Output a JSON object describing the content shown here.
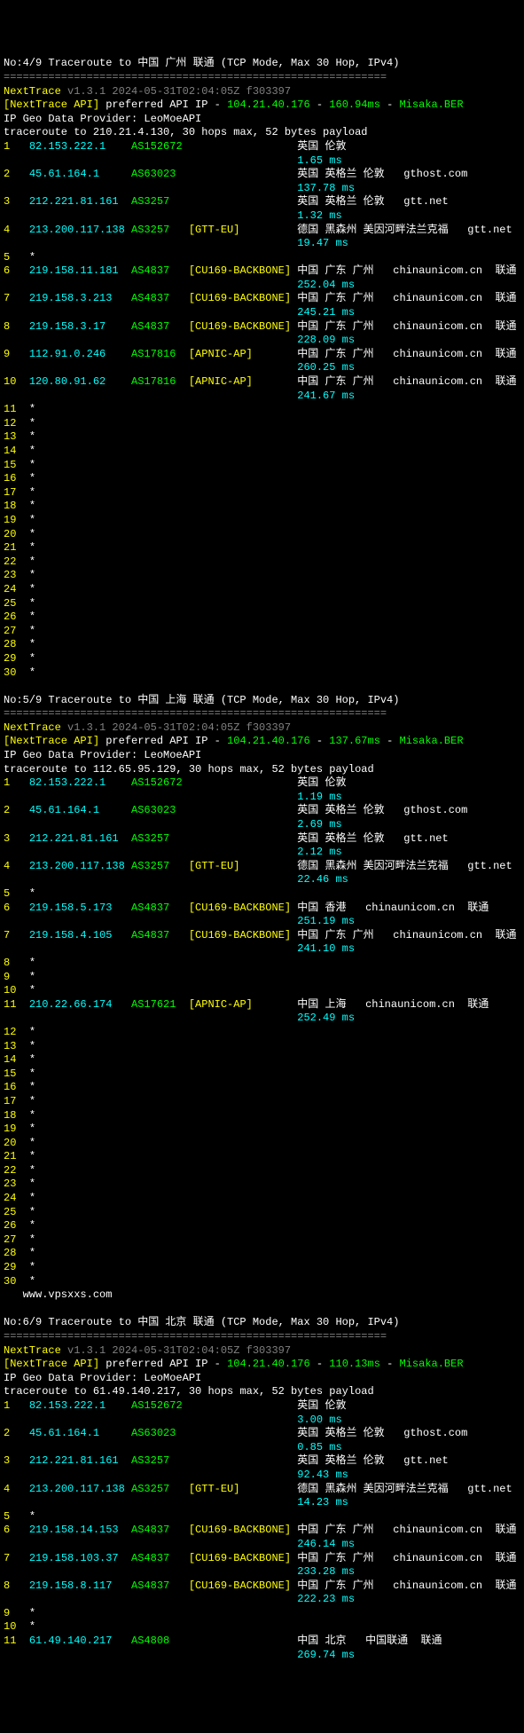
{
  "watermark": "www.vpsxxs.com",
  "traces": [
    {
      "header": "No:4/9 Traceroute to 中国 广州 联通 (TCP Mode, Max 30 Hop, IPv4)",
      "divider": "============================================================",
      "nexttrace_label": "NextTrace",
      "nexttrace_info": " v1.3.1 2024-05-31T02:04:05Z f303397",
      "api_label": "[NextTrace API]",
      "api_text": " preferred API IP - ",
      "api_ip": "104.21.40.176",
      "api_dash": " - ",
      "api_ms": "160.94ms",
      "api_dash2": " - ",
      "api_src": "Misaka.BER",
      "geo_line": "IP Geo Data Provider: LeoMoeAPI",
      "trace_line": "traceroute to 210.21.4.130, 30 hops max, 52 bytes payload",
      "hops": [
        {
          "n": "1",
          "ip": "82.153.222.1",
          "asn": "AS152672",
          "tag": "",
          "loc": "英国 伦敦",
          "ms": "1.65 ms",
          "dom": ""
        },
        {
          "n": "2",
          "ip": "45.61.164.1",
          "asn": "AS63023",
          "tag": "",
          "loc": "英国 英格兰 伦敦",
          "ms": "137.78 ms",
          "dom": "gthost.com"
        },
        {
          "n": "3",
          "ip": "212.221.81.161",
          "asn": "AS3257",
          "tag": "",
          "loc": "英国 英格兰 伦敦",
          "ms": "1.32 ms",
          "dom": "gtt.net"
        },
        {
          "n": "4",
          "ip": "213.200.117.138",
          "asn": "AS3257",
          "tag": "[GTT-EU]",
          "loc": "德国 黑森州 美因河畔法兰克福",
          "ms": "19.47 ms",
          "dom": "gtt.net"
        },
        {
          "n": "5",
          "ip": "*",
          "asn": "",
          "tag": "",
          "loc": "",
          "ms": "",
          "dom": ""
        },
        {
          "n": "6",
          "ip": "219.158.11.181",
          "asn": "AS4837",
          "tag": "[CU169-BACKBONE]",
          "loc": "中国 广东 广州",
          "ms": "252.04 ms",
          "dom": "chinaunicom.cn  联通"
        },
        {
          "n": "7",
          "ip": "219.158.3.213",
          "asn": "AS4837",
          "tag": "[CU169-BACKBONE]",
          "loc": "中国 广东 广州",
          "ms": "245.21 ms",
          "dom": "chinaunicom.cn  联通"
        },
        {
          "n": "8",
          "ip": "219.158.3.17",
          "asn": "AS4837",
          "tag": "[CU169-BACKBONE]",
          "loc": "中国 广东 广州",
          "ms": "228.09 ms",
          "dom": "chinaunicom.cn  联通"
        },
        {
          "n": "9",
          "ip": "112.91.0.246",
          "asn": "AS17816",
          "tag": "[APNIC-AP]",
          "loc": "中国 广东 广州",
          "ms": "260.25 ms",
          "dom": "chinaunicom.cn  联通"
        },
        {
          "n": "10",
          "ip": "120.80.91.62",
          "asn": "AS17816",
          "tag": "[APNIC-AP]",
          "loc": "中国 广东 广州",
          "ms": "241.67 ms",
          "dom": "chinaunicom.cn  联通"
        },
        {
          "n": "11",
          "ip": "*"
        },
        {
          "n": "12",
          "ip": "*"
        },
        {
          "n": "13",
          "ip": "*"
        },
        {
          "n": "14",
          "ip": "*"
        },
        {
          "n": "15",
          "ip": "*"
        },
        {
          "n": "16",
          "ip": "*"
        },
        {
          "n": "17",
          "ip": "*"
        },
        {
          "n": "18",
          "ip": "*"
        },
        {
          "n": "19",
          "ip": "*"
        },
        {
          "n": "20",
          "ip": "*"
        },
        {
          "n": "21",
          "ip": "*"
        },
        {
          "n": "22",
          "ip": "*"
        },
        {
          "n": "23",
          "ip": "*"
        },
        {
          "n": "24",
          "ip": "*"
        },
        {
          "n": "25",
          "ip": "*"
        },
        {
          "n": "26",
          "ip": "*"
        },
        {
          "n": "27",
          "ip": "*"
        },
        {
          "n": "28",
          "ip": "*"
        },
        {
          "n": "29",
          "ip": "*"
        },
        {
          "n": "30",
          "ip": "*"
        }
      ]
    },
    {
      "header": "No:5/9 Traceroute to 中国 上海 联通 (TCP Mode, Max 30 Hop, IPv4)",
      "divider": "============================================================",
      "nexttrace_label": "NextTrace",
      "nexttrace_info": " v1.3.1 2024-05-31T02:04:05Z f303397",
      "api_label": "[NextTrace API]",
      "api_text": " preferred API IP - ",
      "api_ip": "104.21.40.176",
      "api_dash": " - ",
      "api_ms": "137.67ms",
      "api_dash2": " - ",
      "api_src": "Misaka.BER",
      "geo_line": "IP Geo Data Provider: LeoMoeAPI",
      "trace_line": "traceroute to 112.65.95.129, 30 hops max, 52 bytes payload",
      "hops": [
        {
          "n": "1",
          "ip": "82.153.222.1",
          "asn": "AS152672",
          "tag": "",
          "loc": "英国 伦敦",
          "ms": "1.19 ms",
          "dom": ""
        },
        {
          "n": "2",
          "ip": "45.61.164.1",
          "asn": "AS63023",
          "tag": "",
          "loc": "英国 英格兰 伦敦",
          "ms": "2.69 ms",
          "dom": "gthost.com"
        },
        {
          "n": "3",
          "ip": "212.221.81.161",
          "asn": "AS3257",
          "tag": "",
          "loc": "英国 英格兰 伦敦",
          "ms": "2.12 ms",
          "dom": "gtt.net"
        },
        {
          "n": "4",
          "ip": "213.200.117.138",
          "asn": "AS3257",
          "tag": "[GTT-EU]",
          "loc": "德国 黑森州 美因河畔法兰克福",
          "ms": "22.46 ms",
          "dom": "gtt.net"
        },
        {
          "n": "5",
          "ip": "*"
        },
        {
          "n": "6",
          "ip": "219.158.5.173",
          "asn": "AS4837",
          "tag": "[CU169-BACKBONE]",
          "loc": "中国 香港",
          "ms": "251.19 ms",
          "dom": "chinaunicom.cn  联通"
        },
        {
          "n": "7",
          "ip": "219.158.4.105",
          "asn": "AS4837",
          "tag": "[CU169-BACKBONE]",
          "loc": "中国 广东 广州",
          "ms": "241.10 ms",
          "dom": "chinaunicom.cn  联通"
        },
        {
          "n": "8",
          "ip": "*"
        },
        {
          "n": "9",
          "ip": "*"
        },
        {
          "n": "10",
          "ip": "*"
        },
        {
          "n": "11",
          "ip": "210.22.66.174",
          "asn": "AS17621",
          "tag": "[APNIC-AP]",
          "loc": "中国 上海",
          "ms": "252.49 ms",
          "dom": "chinaunicom.cn  联通"
        },
        {
          "n": "12",
          "ip": "*"
        },
        {
          "n": "13",
          "ip": "*"
        },
        {
          "n": "14",
          "ip": "*"
        },
        {
          "n": "15",
          "ip": "*"
        },
        {
          "n": "16",
          "ip": "*"
        },
        {
          "n": "17",
          "ip": "*"
        },
        {
          "n": "18",
          "ip": "*"
        },
        {
          "n": "19",
          "ip": "*"
        },
        {
          "n": "20",
          "ip": "*"
        },
        {
          "n": "21",
          "ip": "*"
        },
        {
          "n": "22",
          "ip": "*"
        },
        {
          "n": "23",
          "ip": "*"
        },
        {
          "n": "24",
          "ip": "*"
        },
        {
          "n": "25",
          "ip": "*"
        },
        {
          "n": "26",
          "ip": "*"
        },
        {
          "n": "27",
          "ip": "*"
        },
        {
          "n": "28",
          "ip": "*"
        },
        {
          "n": "29",
          "ip": "*"
        },
        {
          "n": "30",
          "ip": "*"
        }
      ],
      "watermark_after_hop": "30"
    },
    {
      "header": "No:6/9 Traceroute to 中国 北京 联通 (TCP Mode, Max 30 Hop, IPv4)",
      "divider": "============================================================",
      "nexttrace_label": "NextTrace",
      "nexttrace_info": " v1.3.1 2024-05-31T02:04:05Z f303397",
      "api_label": "[NextTrace API]",
      "api_text": " preferred API IP - ",
      "api_ip": "104.21.40.176",
      "api_dash": " - ",
      "api_ms": "110.13ms",
      "api_dash2": " - ",
      "api_src": "Misaka.BER",
      "geo_line": "IP Geo Data Provider: LeoMoeAPI",
      "trace_line": "traceroute to 61.49.140.217, 30 hops max, 52 bytes payload",
      "hops": [
        {
          "n": "1",
          "ip": "82.153.222.1",
          "asn": "AS152672",
          "tag": "",
          "loc": "英国 伦敦",
          "ms": "3.00 ms",
          "dom": ""
        },
        {
          "n": "2",
          "ip": "45.61.164.1",
          "asn": "AS63023",
          "tag": "",
          "loc": "英国 英格兰 伦敦",
          "ms": "0.85 ms",
          "dom": "gthost.com"
        },
        {
          "n": "3",
          "ip": "212.221.81.161",
          "asn": "AS3257",
          "tag": "",
          "loc": "英国 英格兰 伦敦",
          "ms": "92.43 ms",
          "dom": "gtt.net"
        },
        {
          "n": "4",
          "ip": "213.200.117.138",
          "asn": "AS3257",
          "tag": "[GTT-EU]",
          "loc": "德国 黑森州 美因河畔法兰克福",
          "ms": "14.23 ms",
          "dom": "gtt.net"
        },
        {
          "n": "5",
          "ip": "*"
        },
        {
          "n": "6",
          "ip": "219.158.14.153",
          "asn": "AS4837",
          "tag": "[CU169-BACKBONE]",
          "loc": "中国 广东 广州",
          "ms": "246.14 ms",
          "dom": "chinaunicom.cn  联通"
        },
        {
          "n": "7",
          "ip": "219.158.103.37",
          "asn": "AS4837",
          "tag": "[CU169-BACKBONE]",
          "loc": "中国 广东 广州",
          "ms": "233.28 ms",
          "dom": "chinaunicom.cn  联通"
        },
        {
          "n": "8",
          "ip": "219.158.8.117",
          "asn": "AS4837",
          "tag": "[CU169-BACKBONE]",
          "loc": "中国 广东 广州",
          "ms": "222.23 ms",
          "dom": "chinaunicom.cn  联通"
        },
        {
          "n": "9",
          "ip": "*"
        },
        {
          "n": "10",
          "ip": "*"
        },
        {
          "n": "11",
          "ip": "61.49.140.217",
          "asn": "AS4808",
          "tag": "",
          "loc": "中国 北京",
          "ms": "269.74 ms",
          "dom": "中国联通  联通"
        }
      ]
    }
  ]
}
